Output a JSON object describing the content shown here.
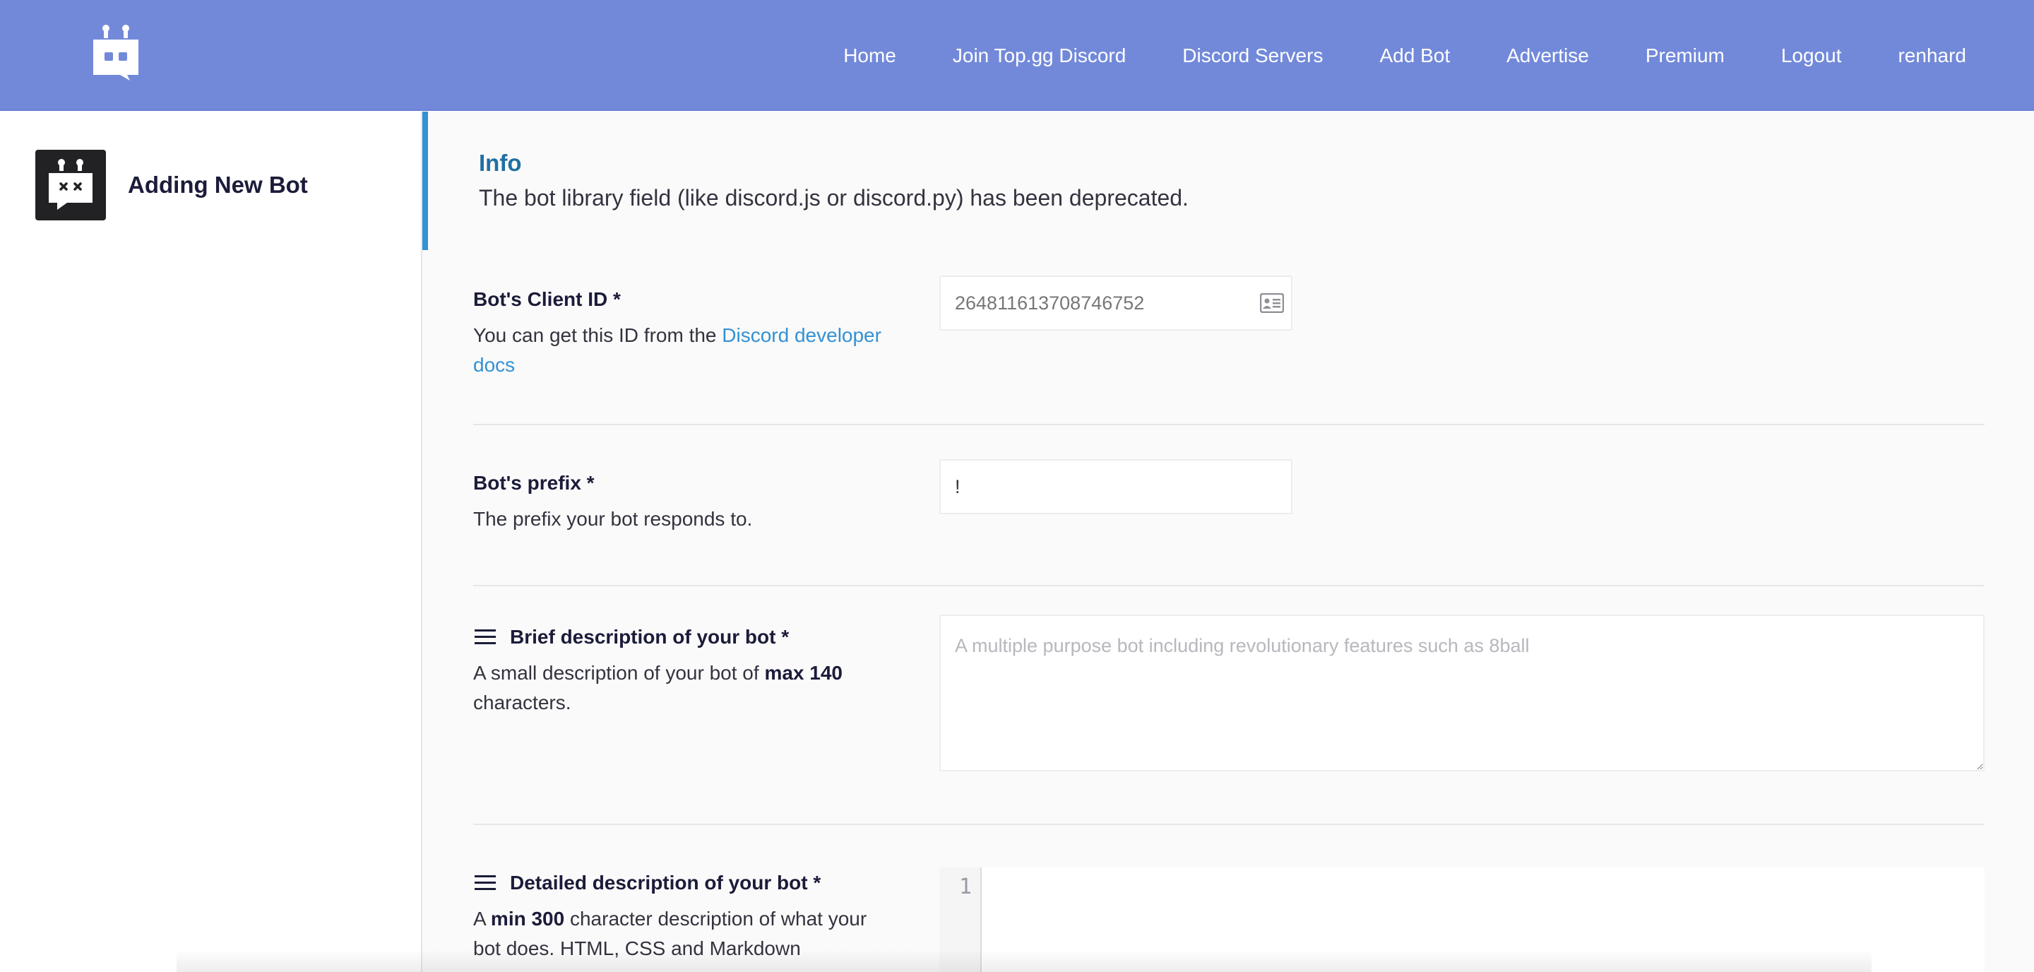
{
  "nav": {
    "links": [
      "Home",
      "Join Top.gg Discord",
      "Discord Servers",
      "Add Bot",
      "Advertise",
      "Premium",
      "Logout",
      "renhard"
    ],
    "logo_icon": "robot-logo-icon",
    "background": "#7289da"
  },
  "sidebar": {
    "title": "Adding New Bot",
    "icon": "robot-chat-icon"
  },
  "info": {
    "title": "Info",
    "text": "The bot library field (like discord.js or discord.py) has been deprecated.",
    "accent": "#3391d4"
  },
  "form": {
    "client_id": {
      "label": "Bot's Client ID *",
      "desc_prefix": "You can get this ID from the ",
      "desc_link": "Discord developer docs",
      "value": "264811613708746752",
      "icon": "id-card-icon"
    },
    "prefix": {
      "label": "Bot's prefix *",
      "desc": "The prefix your bot responds to.",
      "value": "!"
    },
    "brief": {
      "label": "Brief description of your bot *",
      "desc_prefix": "A small description of your bot of ",
      "desc_bold": "max 140",
      "desc_suffix": " characters.",
      "placeholder": "A multiple purpose bot including revolutionary features such as 8ball",
      "icon": "menu-lines-icon"
    },
    "detailed": {
      "label": "Detailed description of your bot *",
      "desc_prefix": "A ",
      "desc_bold": "min 300",
      "desc_suffix": " character description of what your bot does. HTML, CSS and Markdown",
      "line_number": "1",
      "icon": "menu-lines-icon"
    }
  }
}
